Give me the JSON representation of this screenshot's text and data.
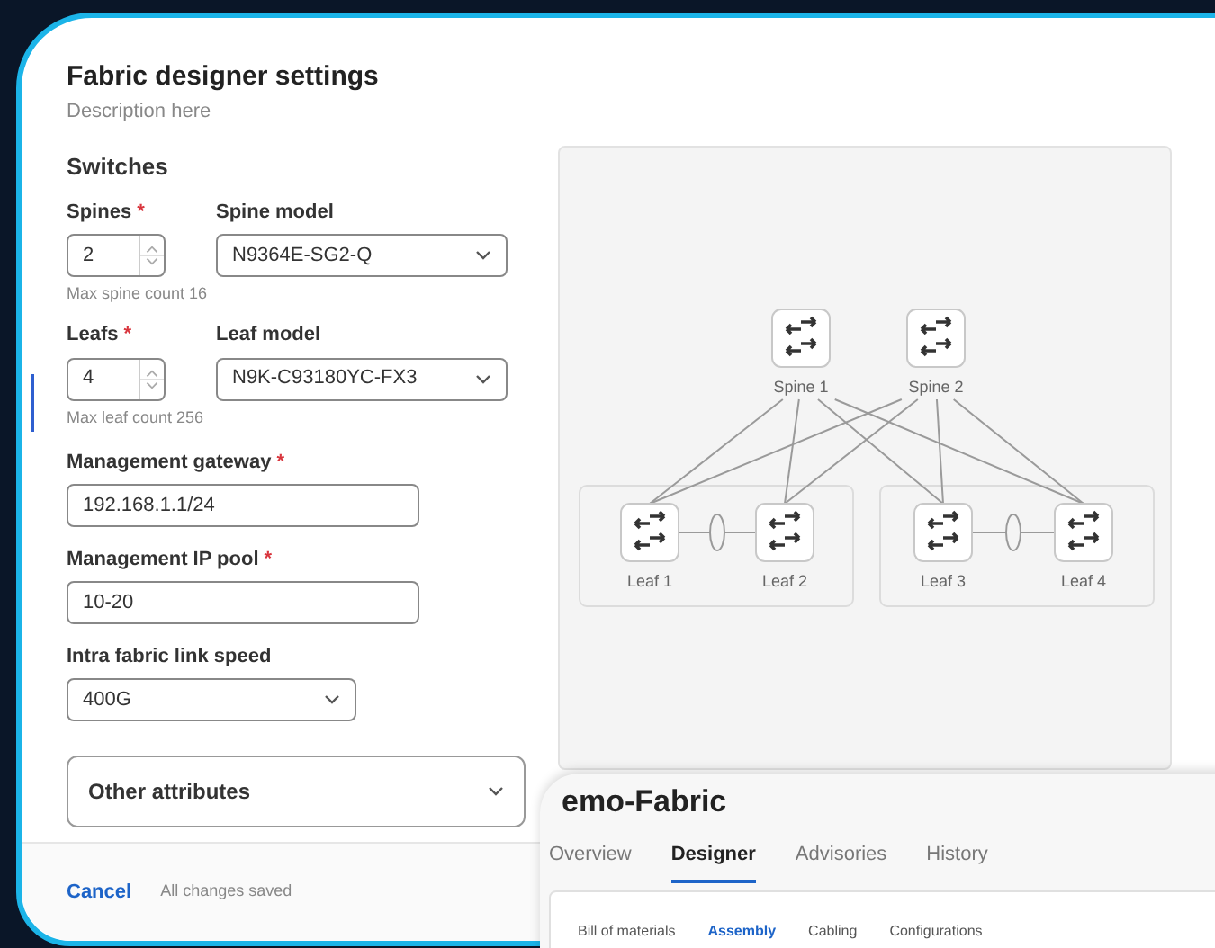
{
  "settings": {
    "title": "Fabric designer settings",
    "description": "Description here",
    "section": "Switches",
    "switch_rows": [
      {
        "count": {
          "label": "Spines",
          "required_mark": "*",
          "value": "2",
          "hint": "Max spine count 16"
        },
        "model": {
          "label": "Spine model",
          "value": "N9364E-SG2-Q"
        }
      },
      {
        "count": {
          "label": "Leafs",
          "required_mark": "*",
          "value": "4",
          "hint": "Max leaf count 256"
        },
        "model": {
          "label": "Leaf model",
          "value": "N9K-C93180YC-FX3"
        }
      }
    ],
    "fields": [
      {
        "kind": "text",
        "label": "Management gateway",
        "required_mark": "*",
        "value": "192.168.1.1/24"
      },
      {
        "kind": "text",
        "label": "Management IP pool",
        "required_mark": "*",
        "value": "10-20"
      },
      {
        "kind": "select",
        "label": "Intra fabric link speed",
        "value": "400G"
      }
    ],
    "accordion": {
      "label": "Other attributes",
      "expanded": false
    },
    "footer": {
      "cancel": "Cancel",
      "status": "All changes saved"
    }
  },
  "diagram": {
    "spines": [
      "Spine 1",
      "Spine 2"
    ],
    "leaves": [
      "Leaf 1",
      "Leaf 2",
      "Leaf 3",
      "Leaf 4"
    ]
  },
  "fabric_page": {
    "title": "emo-Fabric",
    "tabs": [
      {
        "label": "Overview",
        "selected": false
      },
      {
        "label": "Designer",
        "selected": true
      },
      {
        "label": "Advisories",
        "selected": false
      },
      {
        "label": "History",
        "selected": false
      }
    ],
    "subtabs": [
      {
        "label": "Bill of materials",
        "selected": false
      },
      {
        "label": "Assembly",
        "selected": true
      },
      {
        "label": "Cabling",
        "selected": false
      },
      {
        "label": "Configurations",
        "selected": false
      }
    ]
  }
}
